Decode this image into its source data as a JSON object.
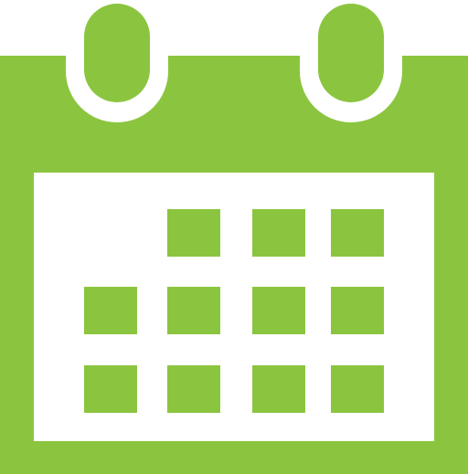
{
  "icon": {
    "name": "calendar-icon",
    "colors": {
      "green": "#8bc53f",
      "white": "#ffffff"
    },
    "grid": {
      "rows": 3,
      "columns": 4,
      "filled_cells": [
        [
          false,
          true,
          true,
          true
        ],
        [
          true,
          true,
          true,
          true
        ],
        [
          true,
          true,
          true,
          true
        ]
      ]
    }
  }
}
